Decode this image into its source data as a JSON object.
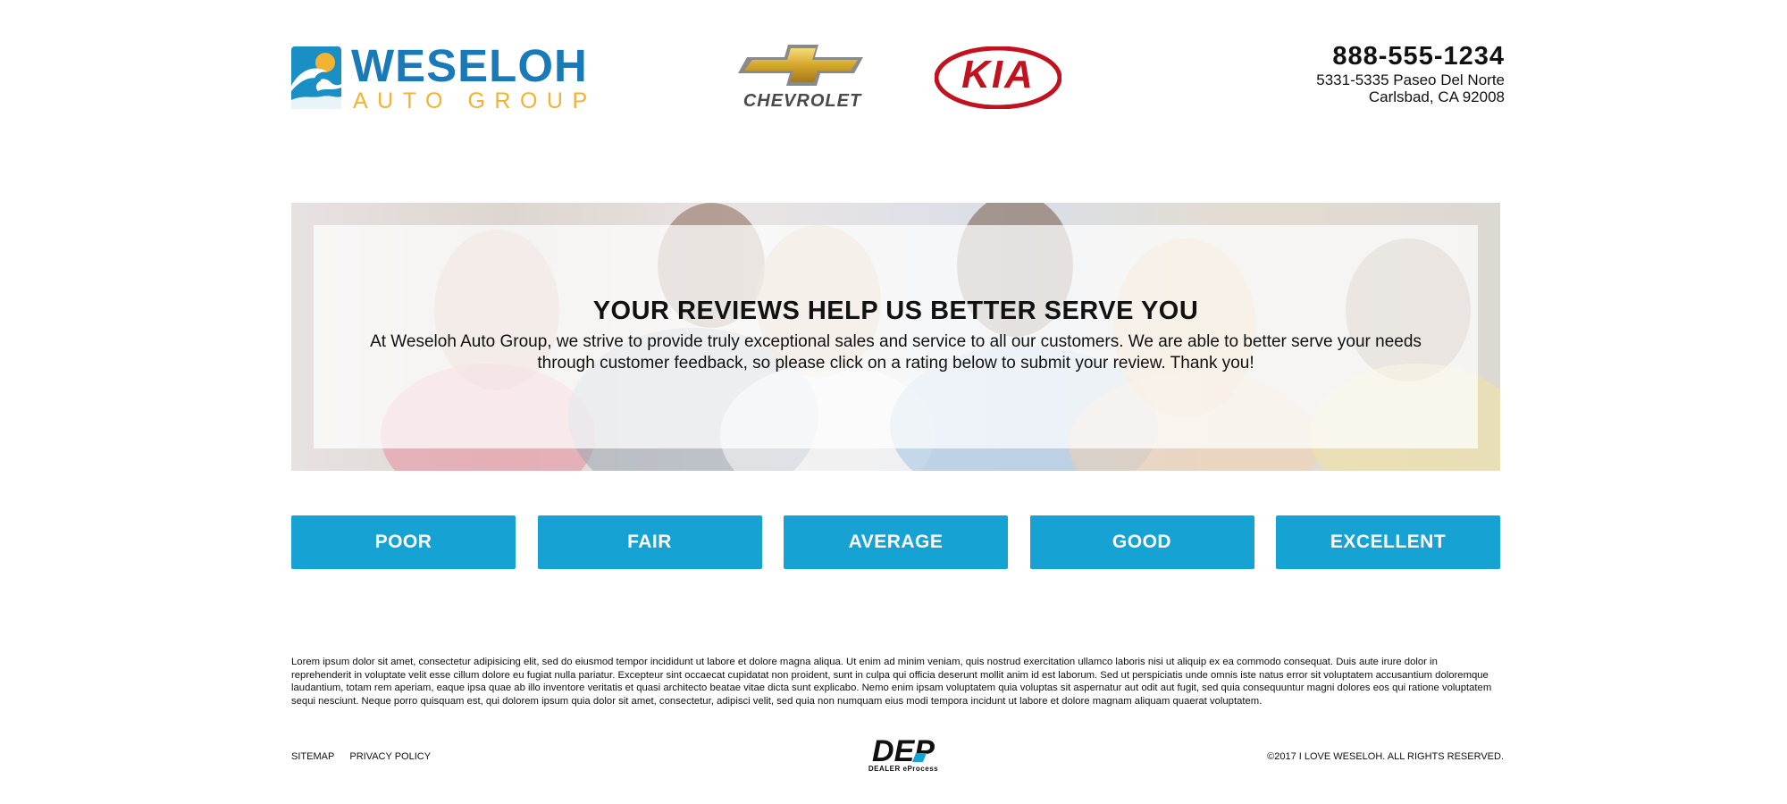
{
  "brand": {
    "name": "WESELOH",
    "subtitle": "AUTO GROUP",
    "colors": {
      "blue": "#1a7ab8",
      "gold": "#f2b233",
      "accent": "#17a2d4"
    }
  },
  "partners": {
    "chevrolet": "CHEVROLET",
    "kia": "KIA"
  },
  "contact": {
    "phone": "888-555-1234",
    "address_line1": "5331-5335 Paseo Del Norte",
    "address_line2": "Carlsbad, CA 92008"
  },
  "hero": {
    "title": "YOUR REVIEWS HELP US BETTER SERVE YOU",
    "text": "At Weseloh Auto Group, we strive to provide truly exceptional sales and service to all our customers. We are able to better serve your needs through customer feedback, so please click on a rating below to submit your review. Thank you!"
  },
  "ratings": {
    "poor": "POOR",
    "fair": "FAIR",
    "average": "AVERAGE",
    "good": "GOOD",
    "excellent": "EXCELLENT"
  },
  "footer": {
    "disclaimer": "Lorem ipsum dolor sit amet, consectetur adipisicing elit, sed do eiusmod tempor incididunt ut labore et dolore magna aliqua. Ut enim ad minim veniam, quis nostrud exercitation ullamco laboris nisi ut aliquip ex ea commodo consequat. Duis aute irure dolor in reprehenderit in voluptate velit esse cillum dolore eu fugiat nulla pariatur. Excepteur sint occaecat cupidatat non proident, sunt in culpa qui officia deserunt mollit anim id est laborum. Sed ut perspiciatis unde omnis iste natus error sit voluptatem accusantium doloremque laudantium, totam rem aperiam, eaque ipsa quae ab illo inventore veritatis et quasi architecto beatae vitae dicta sunt explicabo. Nemo enim ipsam voluptatem quia voluptas sit aspernatur aut odit aut fugit, sed quia consequuntur magni dolores eos qui ratione voluptatem sequi nesciunt. Neque porro quisquam est, qui dolorem ipsum quia dolor sit amet, consectetur, adipisci velit, sed quia non numquam eius modi tempora incidunt ut labore et dolore magnam aliquam quaerat voluptatem.",
    "sitemap": "SITEMAP",
    "privacy": "PRIVACY POLICY",
    "dep_logo": "DEP",
    "dep_label": "DEALER eProcess",
    "copyright": "©2017 I LOVE WESELOH. ALL RIGHTS RESERVED."
  }
}
